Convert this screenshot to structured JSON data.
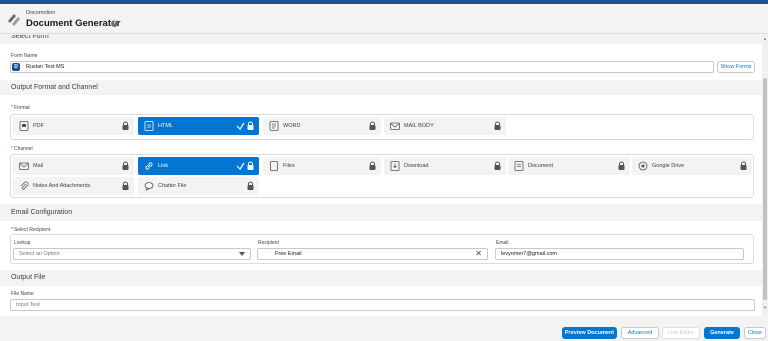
{
  "header": {
    "subtitle": "Docomotion",
    "title": "Document Generator",
    "help_symbol": "?"
  },
  "select_form": {
    "section_title": "Select Form",
    "form_name_label": "Form Name",
    "form_icon_letter": "D",
    "form_name_value": "Ruslan Test MS",
    "show_forms_label": "Show Forms"
  },
  "output": {
    "section_title": "Output Format and Channel",
    "format_label": "Format",
    "formats": [
      "PDF",
      "HTML",
      "WORD",
      "MAIL BODY"
    ],
    "selected_format": "HTML",
    "channel_label": "Channel",
    "channels": [
      "Mail",
      "Link",
      "Files",
      "Download",
      "Document",
      "Google Drive",
      "Notes And Attachments",
      "Chatter File"
    ],
    "selected_channel": "Link"
  },
  "email": {
    "section_title": "Email Configuration",
    "select_recipient_label": "Select Recipient",
    "lookup_label": "Lookup",
    "lookup_placeholder": "Select an Option",
    "recipient_label": "Recipient",
    "recipient_value": "Free Email",
    "email_label": "Email",
    "email_value": "levyomer7@gmail.com"
  },
  "output_file": {
    "section_title": "Output File",
    "file_name_label": "File Name",
    "file_name_placeholder": "Input Text"
  },
  "footer": {
    "preview": "Preview Document",
    "advanced": "Advanced",
    "live_editor": "Live Editor",
    "generate": "Generate",
    "close": "Close"
  },
  "colors": {
    "brand": "#0176d3",
    "header_bar": "#1b5297",
    "required": "#c23934",
    "annotation": "#e53935"
  }
}
